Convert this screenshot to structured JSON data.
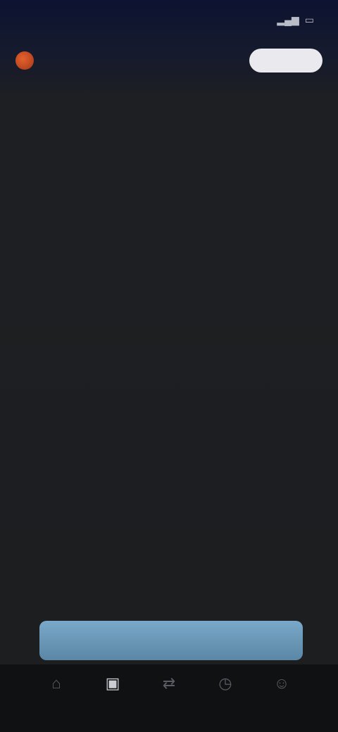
{
  "status_bar": {
    "time": "",
    "signal_icon": "signal-icon",
    "battery_icon": "battery-icon"
  },
  "header": {
    "title": "",
    "button_label": ""
  },
  "hero": {
    "caption": "",
    "value": "",
    "sub": ""
  },
  "details": [
    {
      "label": "",
      "value": ""
    },
    {
      "label": "",
      "value": ""
    },
    {
      "label": "",
      "value": ""
    },
    {
      "label": "",
      "value": ""
    },
    {
      "label": "",
      "value": ""
    },
    {
      "label": "",
      "value": ""
    },
    {
      "label": "",
      "value": ""
    },
    {
      "label": "",
      "value": ""
    },
    {
      "label": "",
      "value": ""
    },
    {
      "label": "",
      "value": ""
    },
    {
      "label": "",
      "value": ""
    }
  ],
  "footer_note": "",
  "primary_action": {
    "label": ""
  },
  "bottom_nav": [
    {
      "icon": "home-icon",
      "label": ""
    },
    {
      "icon": "wallet-icon",
      "label": ""
    },
    {
      "icon": "swap-icon",
      "label": ""
    },
    {
      "icon": "history-icon",
      "label": ""
    },
    {
      "icon": "profile-icon",
      "label": ""
    }
  ],
  "colors": {
    "accent": "#5b87a6",
    "warning": "#d98a48",
    "background": "#1d1e20"
  }
}
